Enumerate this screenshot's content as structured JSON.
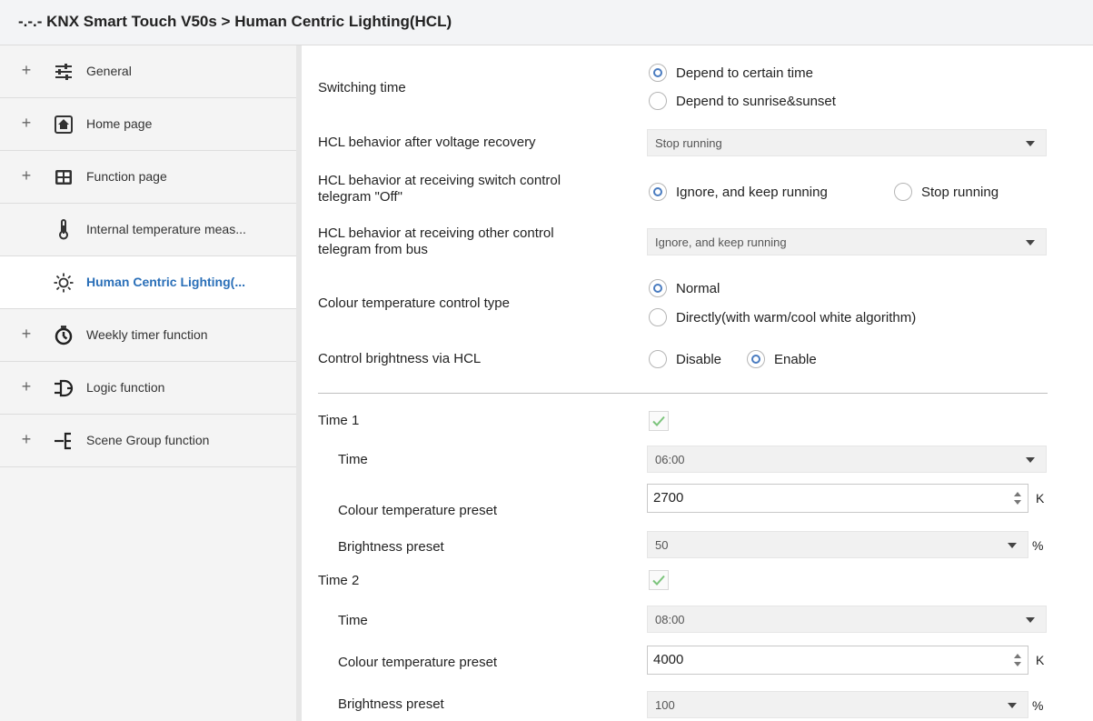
{
  "window": {
    "title": "-.-.- KNX Smart Touch V50s > Human Centric Lighting(HCL)"
  },
  "sidebar": {
    "items": [
      {
        "label": "General",
        "expandable": "+",
        "icon": "sliders-icon"
      },
      {
        "label": "Home page",
        "expandable": "+",
        "icon": "home-icon"
      },
      {
        "label": "Function page",
        "expandable": "+",
        "icon": "grid-icon"
      },
      {
        "label": "Internal temperature meas...",
        "expandable": "",
        "icon": "thermometer-icon"
      },
      {
        "label": "Human Centric Lighting(...",
        "expandable": "",
        "icon": "sun-icon",
        "active": true
      },
      {
        "label": "Weekly timer function",
        "expandable": "+",
        "icon": "timer-icon"
      },
      {
        "label": "Logic function",
        "expandable": "+",
        "icon": "logic-gate-icon"
      },
      {
        "label": "Scene Group function",
        "expandable": "+",
        "icon": "scene-tree-icon"
      }
    ]
  },
  "params": {
    "switching_time": {
      "label": "Switching time",
      "options": [
        "Depend to certain time",
        "Depend to sunrise&sunset"
      ],
      "selected": "Depend to certain time"
    },
    "hcl_after_voltage": {
      "label": "HCL behavior after voltage recovery",
      "value": "Stop running"
    },
    "hcl_switch_off": {
      "label_line1": "HCL behavior at receiving switch control",
      "label_line2": "telegram \"Off\"",
      "options": [
        "Ignore, and keep running",
        "Stop running"
      ],
      "selected": "Ignore, and keep running"
    },
    "hcl_other_control": {
      "label_line1": "HCL behavior at receiving other control",
      "label_line2": "telegram from bus",
      "value": "Ignore, and keep running"
    },
    "colour_control_type": {
      "label": "Colour temperature control type",
      "options": [
        "Normal",
        "Directly(with warm/cool white algorithm)"
      ],
      "selected": "Normal"
    },
    "brightness_via_hcl": {
      "label": "Control brightness via HCL",
      "options": [
        "Disable",
        "Enable"
      ],
      "selected": "Enable"
    }
  },
  "times": [
    {
      "label": "Time 1",
      "enabled": true,
      "time_label": "Time",
      "time_value": "06:00",
      "colour_label": "Colour temperature preset",
      "colour_value": "2700",
      "colour_unit": "K",
      "brightness_label": "Brightness preset",
      "brightness_value": "50",
      "brightness_unit": "%"
    },
    {
      "label": "Time 2",
      "enabled": true,
      "time_label": "Time",
      "time_value": "08:00",
      "colour_label": "Colour temperature preset",
      "colour_value": "4000",
      "colour_unit": "K",
      "brightness_label": "Brightness preset",
      "brightness_value": "100",
      "brightness_unit": "%"
    }
  ],
  "colors": {
    "accent": "#2a6fb8",
    "radio_dot": "#4a7cc0",
    "check": "#7cc47c"
  }
}
